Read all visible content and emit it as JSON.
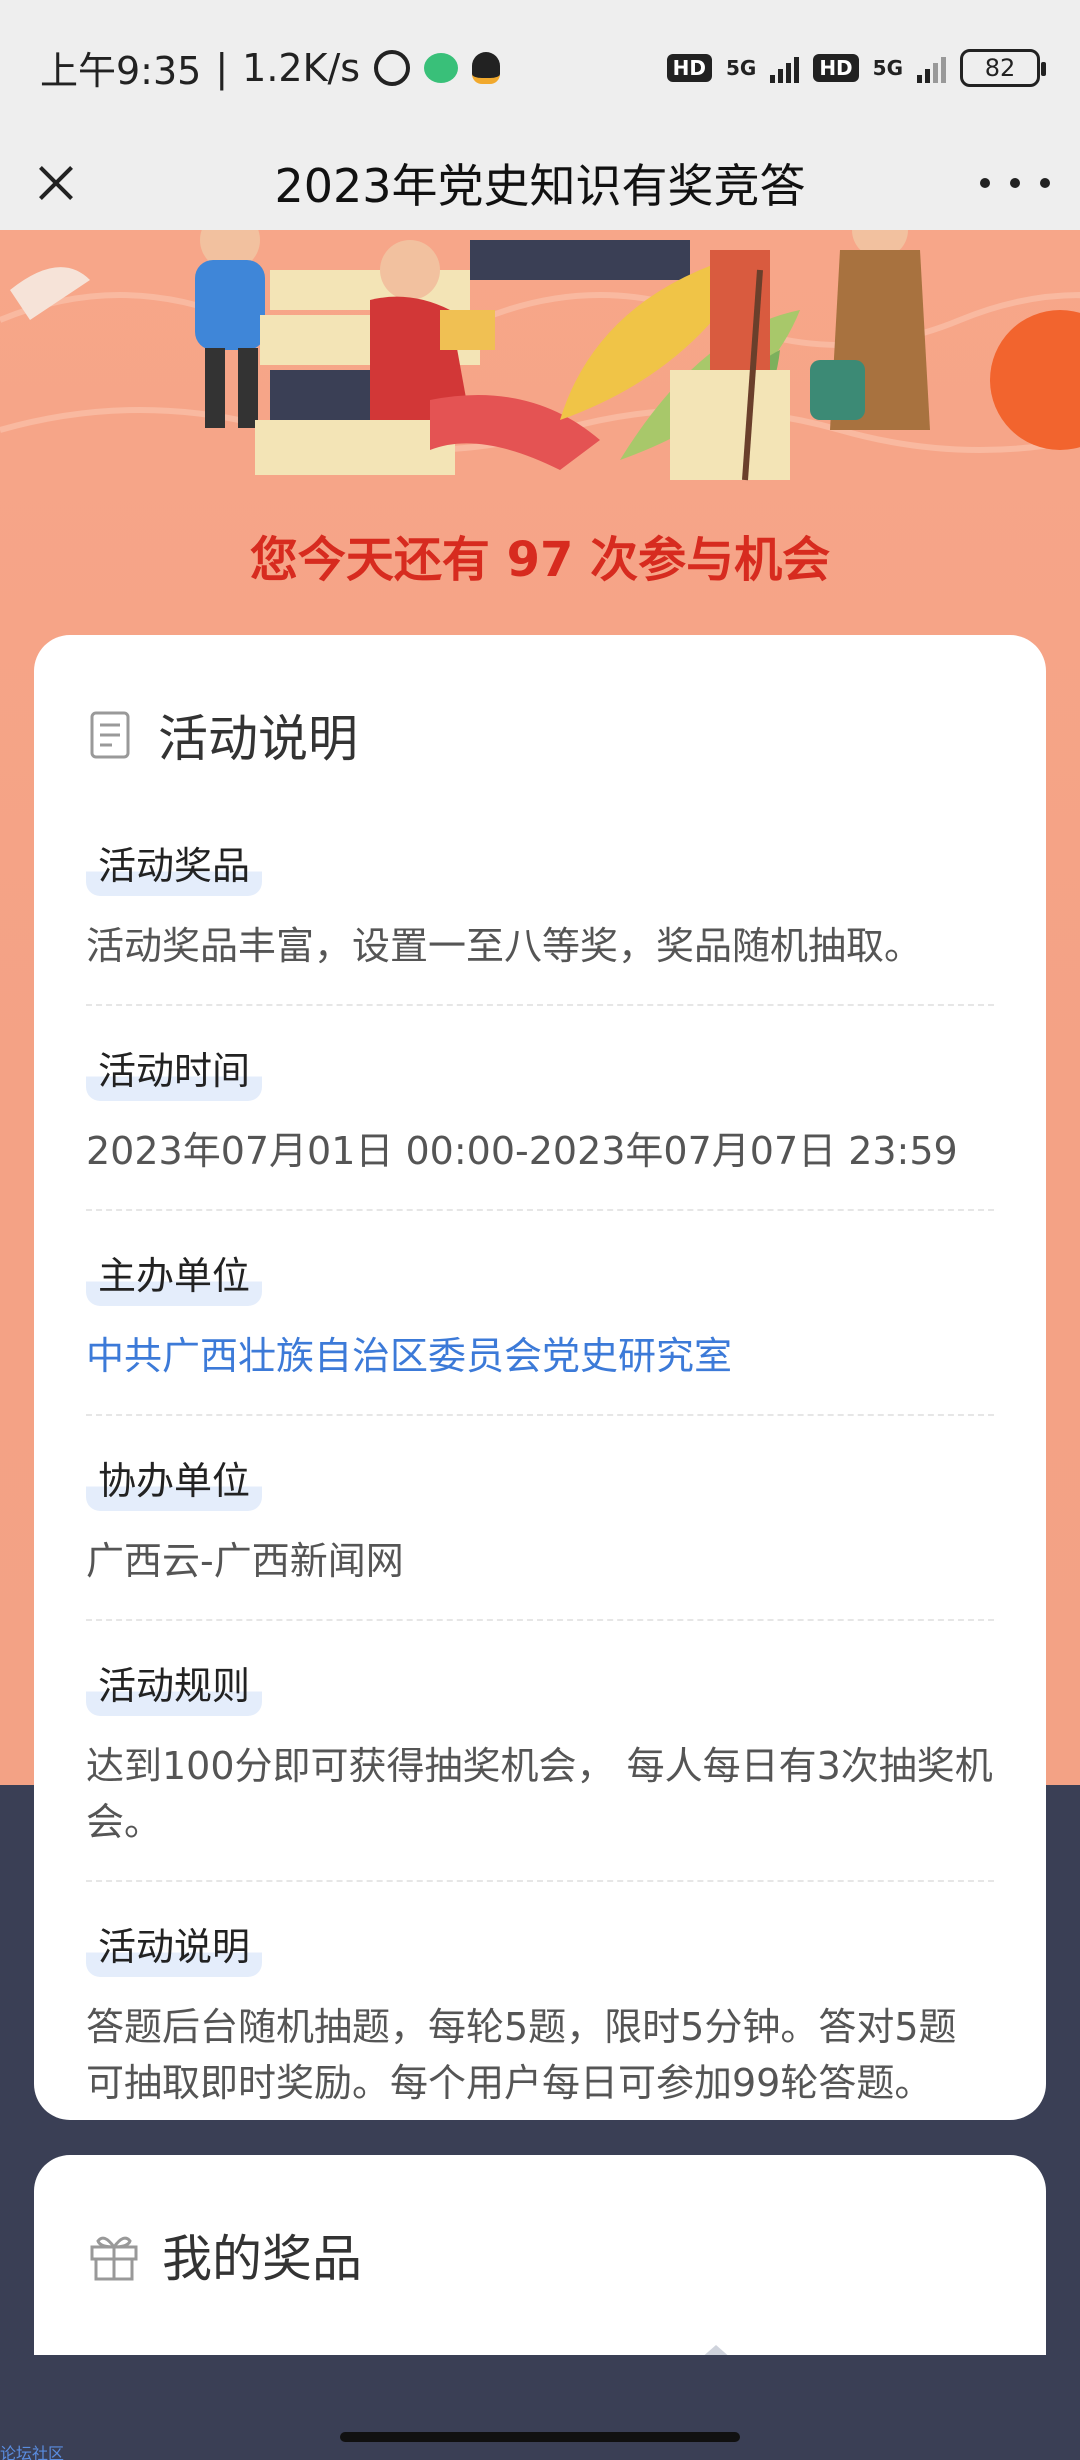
{
  "status_bar": {
    "time": "上午9:35",
    "speed": "1.2K/s",
    "hd1": "HD",
    "net1": "5G",
    "hd2": "HD",
    "net2": "5G",
    "battery": "82"
  },
  "nav": {
    "title": "2023年党史知识有奖竞答"
  },
  "hero": {
    "chances": "您今天还有 97 次参与机会"
  },
  "info_card": {
    "title": "活动说明",
    "sections": [
      {
        "label": "活动奖品",
        "text": "活动奖品丰富，设置一至八等奖，奖品随机抽取。"
      },
      {
        "label": "活动时间",
        "text": "2023年07月01日 00:00-2023年07月07日 23:59"
      },
      {
        "label": "主办单位",
        "text": "中共广西壮族自治区委员会党史研究室"
      },
      {
        "label": "协办单位",
        "text": "广西云-广西新闻网"
      },
      {
        "label": "活动规则",
        "text": "达到100分即可获得抽奖机会， 每人每日有3次抽奖机会。"
      },
      {
        "label": "活动说明",
        "text": "答题后台随机抽题，每轮5题，限时5分钟。答对5题可抽取即时奖励。每个用户每日可参加99轮答题。"
      }
    ]
  },
  "prizes_card": {
    "title": "我的奖品"
  },
  "watermark": "论坛社区",
  "colors": {
    "hero_bg": "#f4a285",
    "chances_text": "#d72b1f",
    "link": "#3c7ad8",
    "footer_bg": "#3a3f55"
  }
}
